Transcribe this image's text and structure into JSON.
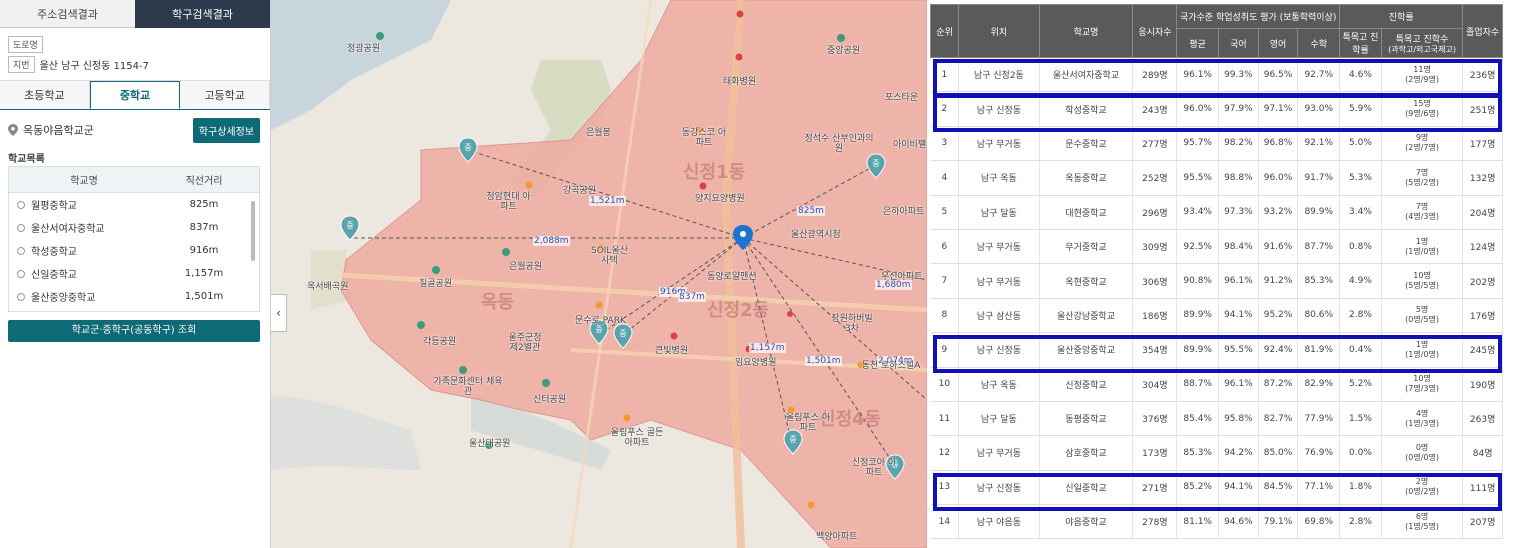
{
  "left_panel": {
    "top_tabs": [
      "주소검색결과",
      "학구검색결과"
    ],
    "address": {
      "road_label": "도로명",
      "lot_label": "지번",
      "lot_value": "울산 남구 신정동 1154-7"
    },
    "level_tabs": [
      "초등학교",
      "중학교",
      "고등학교"
    ],
    "active_level": "중학교",
    "district_name": "옥동야음학교군",
    "detail_button": "학구상세정보",
    "list_title": "학교목록",
    "table_headers": [
      "학교명",
      "직선거리"
    ],
    "schools": [
      {
        "name": "월평중학교",
        "distance": "825m"
      },
      {
        "name": "울산서여자중학교",
        "distance": "837m"
      },
      {
        "name": "학성중학교",
        "distance": "916m"
      },
      {
        "name": "신일중학교",
        "distance": "1,157m"
      },
      {
        "name": "울산중앙중학교",
        "distance": "1,501m"
      }
    ],
    "district_button": "학교군·중학구(공동학구) 조회"
  },
  "map": {
    "place_labels": [
      "정광공원",
      "중앙공원",
      "태화병원",
      "포스타운",
      "은월봉",
      "동강스코 아파트",
      "정석수 산부인과의원",
      "아이비팰",
      "청암현대 아파트",
      "강곡공원",
      "양지요양병원",
      "울산광역시청",
      "은하아파트",
      "은월공원",
      "SOIL울산 사택",
      "동양로얄맨션",
      "옥서배곡원",
      "질골공원",
      "문수로 PARK",
      "울주군청 제2별관",
      "큰빛병원",
      "갹등공원",
      "가족문화센터 체육관",
      "신터공원",
      "올림푸스 골든아파트",
      "울산대공원",
      "임요양병원",
      "동천 로하스빌A",
      "올림푸스 아파트",
      "신정코아 아파트",
      "백양아파트",
      "장원하버빌 3차",
      "우신아파트"
    ],
    "district_labels": [
      "신정1동",
      "옥동",
      "신정2동",
      "신정4동"
    ],
    "distance_labels": [
      "1,521m",
      "825m",
      "2,088m",
      "916m",
      "837m",
      "1,680m",
      "1,157m",
      "1,501m",
      "2,074m"
    ],
    "marker_glyph": "중",
    "collapse_icon": "‹"
  },
  "ranking": {
    "headers": {
      "rank": "순위",
      "location": "위치",
      "school": "학교명",
      "examinees": "응시자수",
      "national_group": "국가수준 학업성취도 평가 (보통학력이상)",
      "avg": "평균",
      "korean": "국어",
      "english": "영어",
      "math": "수학",
      "advancement_group": "진학률",
      "special_rate": "특목고 진학률",
      "special_count": "특목고 진학수",
      "special_count_sub": "(과학고/외고국제고)",
      "graduates": "졸업자수"
    },
    "rows": [
      {
        "rank": "1",
        "loc": "남구 신정2동",
        "school": "울산서여자중학교",
        "exam": "289명",
        "avg": "96.1%",
        "kor": "99.3%",
        "eng": "96.5%",
        "math": "92.7%",
        "srate": "4.6%",
        "scount": "11명",
        "ssub": "(2명/9명)",
        "grad": "236명"
      },
      {
        "rank": "2",
        "loc": "남구 신정동",
        "school": "학성중학교",
        "exam": "243명",
        "avg": "96.0%",
        "kor": "97.9%",
        "eng": "97.1%",
        "math": "93.0%",
        "srate": "5.9%",
        "scount": "15명",
        "ssub": "(9명/6명)",
        "grad": "251명"
      },
      {
        "rank": "3",
        "loc": "남구 무거동",
        "school": "문수중학교",
        "exam": "277명",
        "avg": "95.7%",
        "kor": "98.2%",
        "eng": "96.8%",
        "math": "92.1%",
        "srate": "5.0%",
        "scount": "9명",
        "ssub": "(2명/7명)",
        "grad": "177명"
      },
      {
        "rank": "4",
        "loc": "남구 옥동",
        "school": "옥동중학교",
        "exam": "252명",
        "avg": "95.5%",
        "kor": "98.8%",
        "eng": "96.0%",
        "math": "91.7%",
        "srate": "5.3%",
        "scount": "7명",
        "ssub": "(5명/2명)",
        "grad": "132명"
      },
      {
        "rank": "5",
        "loc": "남구 달동",
        "school": "대현중학교",
        "exam": "296명",
        "avg": "93.4%",
        "kor": "97.3%",
        "eng": "93.2%",
        "math": "89.9%",
        "srate": "3.4%",
        "scount": "7명",
        "ssub": "(4명/3명)",
        "grad": "204명"
      },
      {
        "rank": "6",
        "loc": "남구 무거동",
        "school": "무거중학교",
        "exam": "309명",
        "avg": "92.5%",
        "kor": "98.4%",
        "eng": "91.6%",
        "math": "87.7%",
        "srate": "0.8%",
        "scount": "1명",
        "ssub": "(1명/0명)",
        "grad": "124명"
      },
      {
        "rank": "7",
        "loc": "남구 무거동",
        "school": "옥현중학교",
        "exam": "306명",
        "avg": "90.8%",
        "kor": "96.1%",
        "eng": "91.2%",
        "math": "85.3%",
        "srate": "4.9%",
        "scount": "10명",
        "ssub": "(5명/5명)",
        "grad": "202명"
      },
      {
        "rank": "8",
        "loc": "남구 삼산동",
        "school": "울산강남중학교",
        "exam": "186명",
        "avg": "89.9%",
        "kor": "94.1%",
        "eng": "95.2%",
        "math": "80.6%",
        "srate": "2.8%",
        "scount": "5명",
        "ssub": "(0명/5명)",
        "grad": "176명"
      },
      {
        "rank": "9",
        "loc": "남구 신정동",
        "school": "울산중앙중학교",
        "exam": "354명",
        "avg": "89.9%",
        "kor": "95.5%",
        "eng": "92.4%",
        "math": "81.9%",
        "srate": "0.4%",
        "scount": "1명",
        "ssub": "(1명/0명)",
        "grad": "245명"
      },
      {
        "rank": "10",
        "loc": "남구 옥동",
        "school": "신정중학교",
        "exam": "304명",
        "avg": "88.7%",
        "kor": "96.1%",
        "eng": "87.2%",
        "math": "82.9%",
        "srate": "5.2%",
        "scount": "10명",
        "ssub": "(7명/3명)",
        "grad": "190명"
      },
      {
        "rank": "11",
        "loc": "남구 달동",
        "school": "동평중학교",
        "exam": "376명",
        "avg": "85.4%",
        "kor": "95.8%",
        "eng": "82.7%",
        "math": "77.9%",
        "srate": "1.5%",
        "scount": "4명",
        "ssub": "(1명/3명)",
        "grad": "263명"
      },
      {
        "rank": "12",
        "loc": "남구 무거동",
        "school": "삼호중학교",
        "exam": "173명",
        "avg": "85.3%",
        "kor": "94.2%",
        "eng": "85.0%",
        "math": "76.9%",
        "srate": "0.0%",
        "scount": "0명",
        "ssub": "(0명/0명)",
        "grad": "84명"
      },
      {
        "rank": "13",
        "loc": "남구 신정동",
        "school": "신일중학교",
        "exam": "271명",
        "avg": "85.2%",
        "kor": "94.1%",
        "eng": "84.5%",
        "math": "77.1%",
        "srate": "1.8%",
        "scount": "2명",
        "ssub": "(0명/2명)",
        "grad": "111명"
      },
      {
        "rank": "14",
        "loc": "남구 야음동",
        "school": "야음중학교",
        "exam": "278명",
        "avg": "81.1%",
        "kor": "94.6%",
        "eng": "79.1%",
        "math": "69.8%",
        "srate": "2.8%",
        "scount": "6명",
        "ssub": "(1명/5명)",
        "grad": "207명"
      }
    ],
    "highlight_color": "#1010b8"
  }
}
